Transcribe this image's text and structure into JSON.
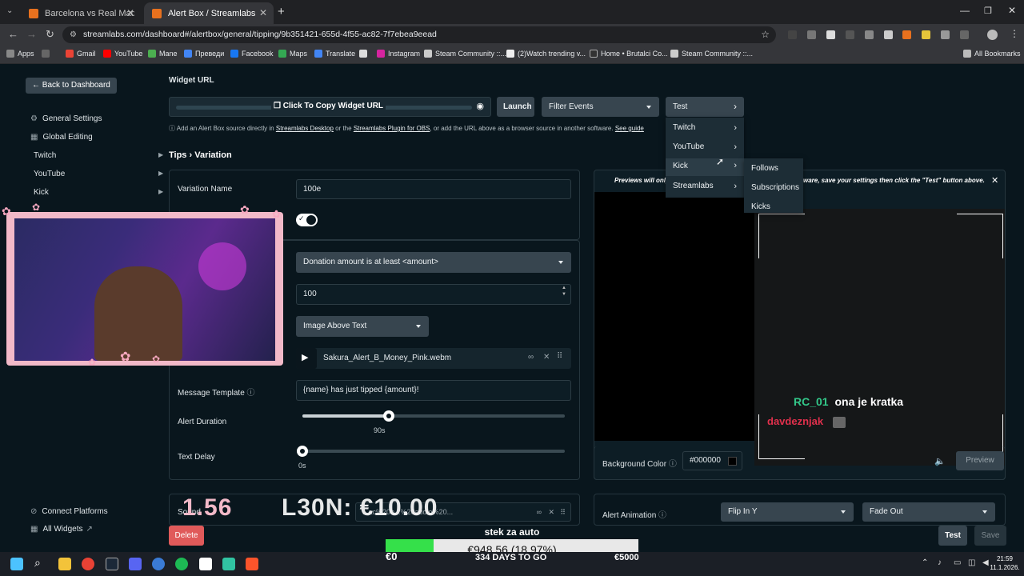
{
  "browser": {
    "tabs": [
      {
        "title": "Barcelona vs Real Madrid Live S",
        "active": false
      },
      {
        "title": "Alert Box / Streamlabs",
        "active": true
      }
    ],
    "new_tab": "+",
    "url": "streamlabs.com/dashboard#/alertbox/general/tipping/9b351421-655d-4f55-ac82-7f7ebea9eead",
    "bookmarks": [
      "Apps",
      "Gmail",
      "YouTube",
      "Mane",
      "Преведи",
      "Facebook",
      "Maps",
      "Translate",
      "Instagram",
      "Steam Community ::...",
      "(2)Watch trending v...",
      "Home • Brutalci Co...",
      "Steam Community ::..."
    ],
    "all_bookmarks": "All Bookmarks"
  },
  "sidebar": {
    "back": "Back to Dashboard",
    "items": [
      {
        "label": "General Settings",
        "icon": "gear-icon"
      },
      {
        "label": "Global Editing",
        "icon": "grid-icon"
      },
      {
        "label": "Twitch"
      },
      {
        "label": "YouTube"
      },
      {
        "label": "Kick"
      }
    ],
    "connect": "Connect Platforms",
    "all_widgets": "All Widgets"
  },
  "widget": {
    "heading": "Widget URL",
    "copy_label": "Click To Copy Widget URL",
    "launch": "Launch",
    "filter": "Filter Events",
    "test": "Test",
    "info_pre": "Add an Alert Box source directly in",
    "info_link1": "Streamlabs Desktop",
    "info_mid": "or the",
    "info_link2": "Streamlabs Plugin for OBS",
    "info_post": ", or add the URL above as a browser source in another software.",
    "info_link3": "See guide"
  },
  "test_menu": {
    "items": [
      "Twitch",
      "YouTube",
      "Kick",
      "Streamlabs"
    ],
    "submenu": [
      "Follows",
      "Subscriptions",
      "Kicks"
    ]
  },
  "form": {
    "breadcrumb_a": "Tips",
    "breadcrumb_sep": "›",
    "breadcrumb_b": "Variation",
    "variation_name_label": "Variation Name",
    "variation_name": "100e",
    "condition": "Donation amount is at least <amount>",
    "amount": "100",
    "layout": "Image Above Text",
    "media_file": "Sakura_Alert_B_Money_Pink.webm",
    "message_label": "Message Template",
    "message": "{name} has just tipped {amount}!",
    "duration_label": "Alert Duration",
    "duration_value": "90s",
    "duration_fraction": 0.33,
    "delay_label": "Text Delay",
    "delay_value": "0s",
    "delay_fraction": 0.0,
    "sound_label": "Sound",
    "sound_value": "...ac%20b...%20audio%20...",
    "delete": "Delete"
  },
  "preview": {
    "notice_left": "Previews will only",
    "notice_right": "ware, save your settings then click the \"Test\" button above.",
    "bg_label": "Background Color",
    "bg_value": "#000000",
    "preview_btn": "Preview",
    "chat_user1": "RC_01",
    "chat_msg1": "ona je kratka",
    "chat_user2": "davdeznjak",
    "anim_label": "Alert Animation",
    "anim_in": "Flip In Y",
    "anim_out": "Fade Out",
    "test_btn": "Test",
    "save_btn": "Save"
  },
  "overlay": {
    "big_left": "1.56",
    "big_right": "L30N: €10.00",
    "goal_title": "stek za auto",
    "goal_amount": "€948.56 (18.97%)",
    "goal_fraction": 0.19,
    "goal_min": "€0",
    "goal_days": "334 DAYS TO GO",
    "goal_max": "€5000"
  },
  "taskbar": {
    "time": "21:59",
    "date": "11.1.2026."
  },
  "colors": {
    "accent_red": "#e05a5a",
    "goal_green": "#35e04a",
    "chat_green": "#33c98a",
    "chat_red": "#e0304c",
    "webcam_pink": "#f2b9c8"
  }
}
